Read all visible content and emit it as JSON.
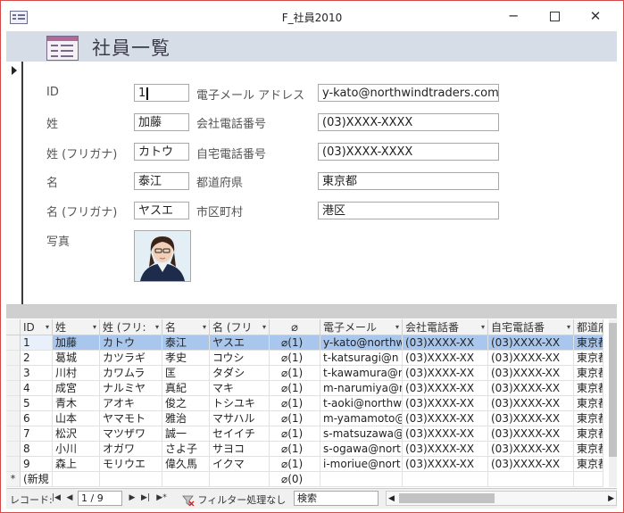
{
  "window": {
    "title": "F_社員2010",
    "minimize": "─",
    "close": "✕"
  },
  "header": {
    "title": "社員一覧"
  },
  "form": {
    "labels": {
      "id": "ID",
      "sei": "姓",
      "sei_kana": "姓 (フリガナ)",
      "mei": "名",
      "mei_kana": "名 (フリガナ)",
      "photo": "写真",
      "email": "電子メール アドレス",
      "work_phone": "会社電話番号",
      "home_phone": "自宅電話番号",
      "prefecture": "都道府県",
      "city": "市区町村"
    },
    "values": {
      "id": "1",
      "sei": "加藤",
      "sei_kana": "カトウ",
      "mei": "泰江",
      "mei_kana": "ヤスエ",
      "email": "y-kato@northwindtraders.com",
      "work_phone": "(03)XXXX-XXXX",
      "home_phone": "(03)XXXX-XXXX",
      "prefecture": "東京都",
      "city": "港区"
    }
  },
  "datasheet": {
    "columns": [
      "ID",
      "姓",
      "姓 (フリ:",
      "名",
      "名 (フリ",
      "",
      "電子メール",
      "会社電話番",
      "自宅電話番",
      "都道府"
    ],
    "rows": [
      [
        "1",
        "加藤",
        "カトウ",
        "泰江",
        "ヤスエ",
        "(1)",
        "y-kato@northw",
        "(03)XXXX-XX",
        "(03)XXXX-XX",
        "東京都"
      ],
      [
        "2",
        "葛城",
        "カツラギ",
        "孝史",
        "コウシ",
        "(1)",
        "t-katsuragi@n",
        "(03)XXXX-XX",
        "(03)XXXX-XX",
        "東京都"
      ],
      [
        "3",
        "川村",
        "カワムラ",
        "匡",
        "タダシ",
        "(1)",
        "t-kawamura@n",
        "(03)XXXX-XX",
        "(03)XXXX-XX",
        "東京都"
      ],
      [
        "4",
        "成宮",
        "ナルミヤ",
        "真紀",
        "マキ",
        "(1)",
        "m-narumiya@r",
        "(03)XXXX-XX",
        "(03)XXXX-XX",
        "東京都"
      ],
      [
        "5",
        "青木",
        "アオキ",
        "俊之",
        "トシユキ",
        "(1)",
        "t-aoki@northw",
        "(03)XXXX-XX",
        "(03)XXXX-XX",
        "東京都"
      ],
      [
        "6",
        "山本",
        "ヤマモト",
        "雅治",
        "マサハル",
        "(1)",
        "m-yamamoto@",
        "(03)XXXX-XX",
        "(03)XXXX-XX",
        "東京都"
      ],
      [
        "7",
        "松沢",
        "マツザワ",
        "誠一",
        "セイイチ",
        "(1)",
        "s-matsuzawa@",
        "(03)XXXX-XX",
        "(03)XXXX-XX",
        "東京都"
      ],
      [
        "8",
        "小川",
        "オガワ",
        "さよ子",
        "サヨコ",
        "(1)",
        "s-ogawa@nort",
        "(03)XXXX-XX",
        "(03)XXXX-XX",
        "東京都"
      ],
      [
        "9",
        "森上",
        "モリウエ",
        "偉久馬",
        "イクマ",
        "(1)",
        "i-moriue@nort",
        "(03)XXXX-XX",
        "(03)XXXX-XX",
        "東京都"
      ]
    ],
    "new_row": {
      "marker": "*",
      "id": "(新規",
      "attach": "(0)"
    }
  },
  "navigation": {
    "record_label": "レコード:",
    "position": "1 / 9",
    "filter": "フィルター処理なし",
    "search": "検索",
    "first": "|◀",
    "prev": "◀",
    "next": "▶",
    "last": "▶|",
    "new": "▶*"
  },
  "icons": {
    "attachment": "paperclip-icon",
    "filter": "filter-off-icon",
    "form": "form-icon"
  }
}
